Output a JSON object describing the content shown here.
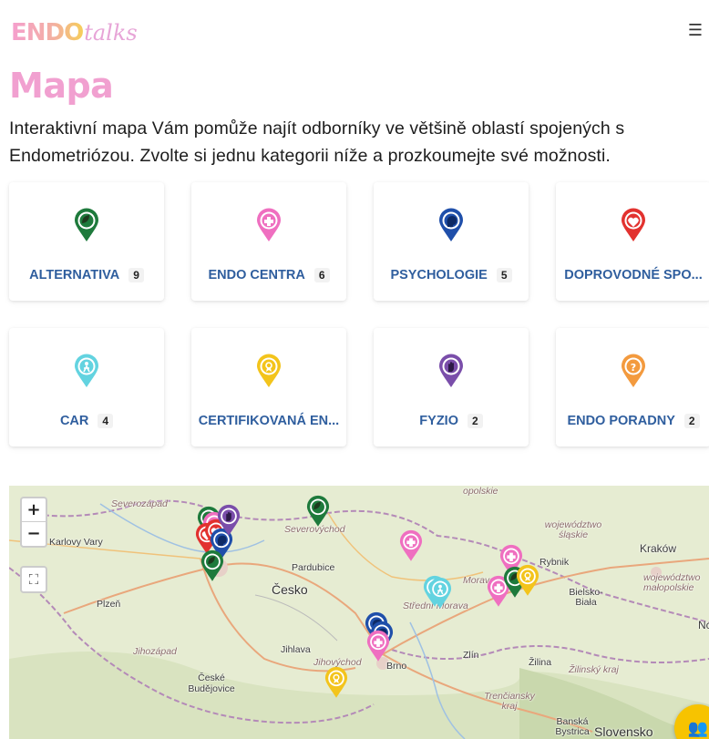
{
  "header": {
    "logo_part1": "ENDO",
    "logo_part2": "talks",
    "menu_icon": "☰"
  },
  "page": {
    "title": "Mapa",
    "intro": "Interaktivní mapa Vám pomůže najít odborníky ve většině oblastí spojených s Endometriózou. Zvolte si jednu kategorii níže a prozkoumejte své možnosti."
  },
  "categories": [
    {
      "label": "ALTERNATIVA",
      "count": "9",
      "color": "#1e7a3c",
      "icon": "leaf-icon"
    },
    {
      "label": "ENDO CENTRA",
      "count": "6",
      "color": "#ef6fc0",
      "icon": "plus-icon"
    },
    {
      "label": "PSYCHOLOGIE",
      "count": "5",
      "color": "#1f4faa",
      "icon": "head-icon"
    },
    {
      "label": "DOPROVODNÉ SPO...",
      "count": "",
      "color": "#e2322f",
      "icon": "heart-icon"
    },
    {
      "label": "CAR",
      "count": "4",
      "color": "#63d3e0",
      "icon": "person-icon"
    },
    {
      "label": "CERTIFIKOVANÁ EN...",
      "count": "",
      "color": "#f3c41c",
      "icon": "award-icon"
    },
    {
      "label": "FYZIO",
      "count": "2",
      "color": "#7a4eaa",
      "icon": "hand-icon"
    },
    {
      "label": "ENDO PORADNY",
      "count": "2",
      "color": "#f39a3e",
      "icon": "question-icon"
    }
  ],
  "map": {
    "zoom_in": "+",
    "zoom_out": "−",
    "fullscreen_icon": "⛶",
    "people_icon": "👥",
    "labels": [
      "Severozápad",
      "Karlovy Vary",
      "Severovýchod",
      "Pardubice",
      "Česko",
      "Plzeň",
      "Jihozápad",
      "Jihlava",
      "Jihovýchod",
      "Brno",
      "České Budějovice",
      "opolskie",
      "województwo śląskie",
      "Rybnik",
      "Kraków",
      "województwo małopolskie",
      "Morava",
      "Střední Morava",
      "Bielsko-Biała",
      "Zlín",
      "Žilina",
      "Žilinský kraj",
      "Trenčiansky kraj",
      "Banská Bystrica",
      "Slovensko",
      "Nc"
    ]
  }
}
